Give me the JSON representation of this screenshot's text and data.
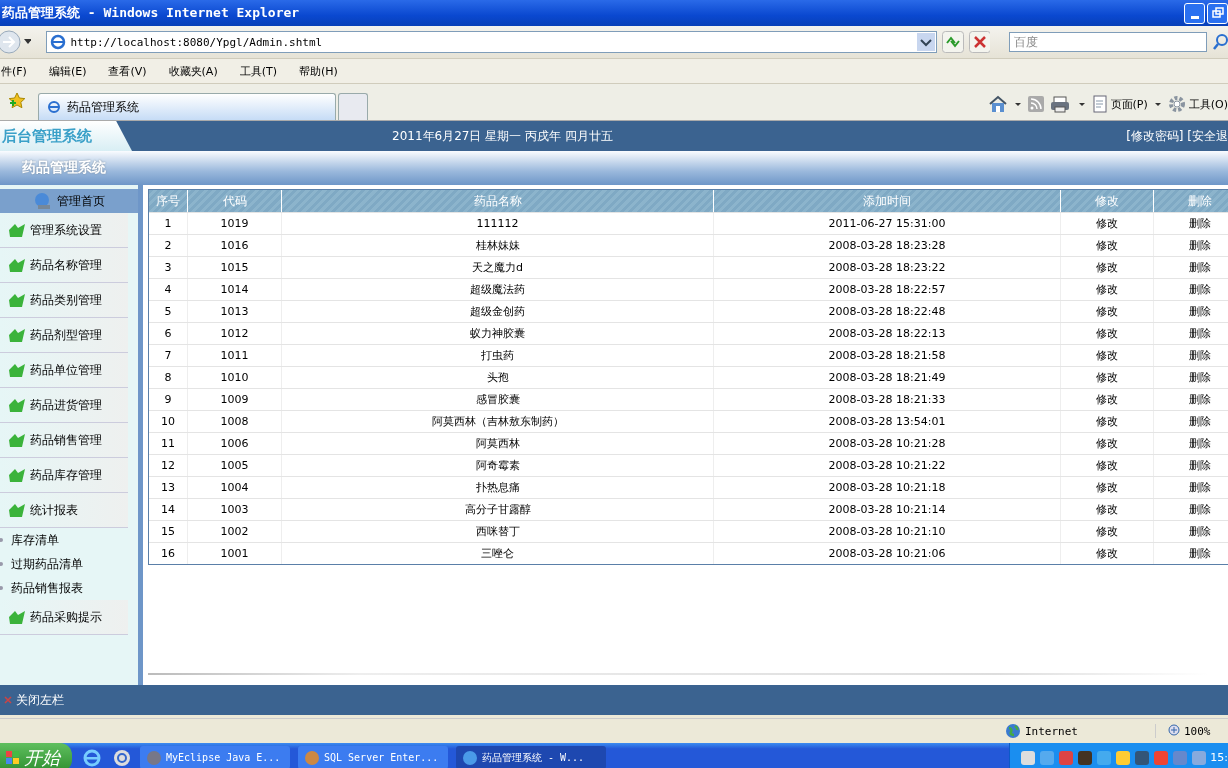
{
  "window": {
    "title": "药品管理系统 - Windows Internet Explorer"
  },
  "address_bar": {
    "url": "http://localhost:8080/Ypgl/Admin.shtml",
    "search_placeholder": "百度"
  },
  "menu": [
    "件(F)",
    "编辑(E)",
    "查看(V)",
    "收藏夹(A)",
    "工具(T)",
    "帮助(H)"
  ],
  "tabs": [
    {
      "label": "药品管理系统",
      "selected": true
    },
    {
      "selected": false
    }
  ],
  "toolbar": {
    "page": "页面(P)",
    "tools": "工具(O)"
  },
  "header": {
    "logo": "后台管理系统",
    "date": "2011年6月27日 星期一 丙戌年 四月廿五",
    "links": "[修改密码] [安全退"
  },
  "subheader": "药品管理系统",
  "sidebar": {
    "home": "管理首页",
    "items": [
      {
        "kind": "menu",
        "label": "管理系统设置"
      },
      {
        "kind": "menu",
        "label": "药品名称管理"
      },
      {
        "kind": "menu",
        "label": "药品类别管理"
      },
      {
        "kind": "menu",
        "label": "药品剂型管理"
      },
      {
        "kind": "menu",
        "label": "药品单位管理"
      },
      {
        "kind": "menu",
        "label": "药品进货管理"
      },
      {
        "kind": "menu",
        "label": "药品销售管理"
      },
      {
        "kind": "menu",
        "label": "药品库存管理"
      },
      {
        "kind": "menu",
        "label": "统计报表"
      },
      {
        "kind": "sub",
        "label": "库存清单"
      },
      {
        "kind": "sub",
        "label": "过期药品清单"
      },
      {
        "kind": "sub",
        "label": "药品销售报表"
      },
      {
        "kind": "menu",
        "label": "药品采购提示"
      }
    ]
  },
  "table": {
    "columns": [
      "序号",
      "代码",
      "药品名称",
      "添加时间",
      "修改",
      "删除"
    ],
    "rows": [
      [
        "1",
        "1019",
        "111112",
        "2011-06-27 15:31:00",
        "修改",
        "删除"
      ],
      [
        "2",
        "1016",
        "桂林妹妹",
        "2008-03-28 18:23:28",
        "修改",
        "删除"
      ],
      [
        "3",
        "1015",
        "天之魔力d",
        "2008-03-28 18:23:22",
        "修改",
        "删除"
      ],
      [
        "4",
        "1014",
        "超级魔法药",
        "2008-03-28 18:22:57",
        "修改",
        "删除"
      ],
      [
        "5",
        "1013",
        "超级金创药",
        "2008-03-28 18:22:48",
        "修改",
        "删除"
      ],
      [
        "6",
        "1012",
        "蚁力神胶囊",
        "2008-03-28 18:22:13",
        "修改",
        "删除"
      ],
      [
        "7",
        "1011",
        "打虫药",
        "2008-03-28 18:21:58",
        "修改",
        "删除"
      ],
      [
        "8",
        "1010",
        "头孢",
        "2008-03-28 18:21:49",
        "修改",
        "删除"
      ],
      [
        "9",
        "1009",
        "感冒胶囊",
        "2008-03-28 18:21:33",
        "修改",
        "删除"
      ],
      [
        "10",
        "1008",
        "阿莫西林（吉林敖东制药）",
        "2008-03-28 13:54:01",
        "修改",
        "删除"
      ],
      [
        "11",
        "1006",
        "阿莫西林",
        "2008-03-28 10:21:28",
        "修改",
        "删除"
      ],
      [
        "12",
        "1005",
        "阿奇霉素",
        "2008-03-28 10:21:22",
        "修改",
        "删除"
      ],
      [
        "13",
        "1004",
        "扑热息痛",
        "2008-03-28 10:21:18",
        "修改",
        "删除"
      ],
      [
        "14",
        "1003",
        "高分子甘露醇",
        "2008-03-28 10:21:14",
        "修改",
        "删除"
      ],
      [
        "15",
        "1002",
        "西咪替丁",
        "2008-03-28 10:21:10",
        "修改",
        "删除"
      ],
      [
        "16",
        "1001",
        "三唑仑",
        "2008-03-28 10:21:06",
        "修改",
        "删除"
      ]
    ]
  },
  "footer": "关闭左栏",
  "status_bar": {
    "zone": "Internet",
    "zoom": "100%"
  },
  "taskbar": {
    "start": "开始",
    "tasks": [
      {
        "label": "MyEclipse Java E...",
        "selected": false
      },
      {
        "label": "SQL Server Enter...",
        "selected": false
      },
      {
        "label": "药品管理系统 - W...",
        "selected": true
      }
    ],
    "clock": "15:"
  }
}
